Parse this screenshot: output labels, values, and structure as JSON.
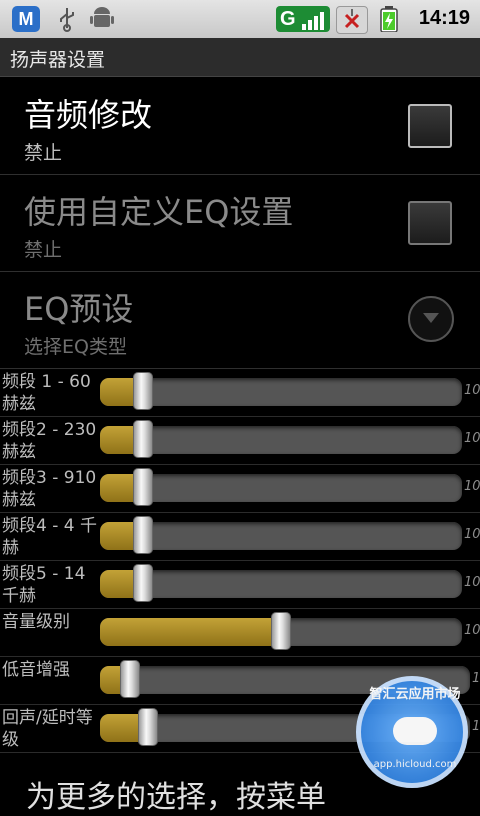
{
  "status_bar": {
    "app_icon_letter": "M",
    "network_letter": "G",
    "time": "14:19",
    "icons": [
      "m-app-icon",
      "usb-icon",
      "android-debug-icon",
      "network-signal-icon",
      "sim-card-icon",
      "battery-charging-icon"
    ]
  },
  "title": "扬声器设置",
  "prefs": [
    {
      "title": "音频修改",
      "summary": "禁止",
      "control": "checkbox",
      "checked": false,
      "enabled": true
    },
    {
      "title": "使用自定义EQ设置",
      "summary": "禁止",
      "control": "checkbox",
      "checked": false,
      "enabled": false
    },
    {
      "title": "EQ预设",
      "summary": "选择EQ类型",
      "control": "dropdown",
      "enabled": false
    }
  ],
  "bands": [
    {
      "label": "频段 1 - 60 赫兹",
      "max": "10",
      "value_fraction": 0.12
    },
    {
      "label": "频段2 - 230 赫兹",
      "max": "10",
      "value_fraction": 0.12
    },
    {
      "label": "频段3 - 910 赫兹",
      "max": "10",
      "value_fraction": 0.12
    },
    {
      "label": "频段4 - 4 千赫",
      "max": "10",
      "value_fraction": 0.12
    },
    {
      "label": "频段5 - 14 千赫",
      "max": "10",
      "value_fraction": 0.12
    },
    {
      "label": "音量级别",
      "max": "10",
      "value_fraction": 0.5
    },
    {
      "label": "低音增强",
      "max": "1",
      "value_fraction": 0.08
    },
    {
      "label": "回声/延时等级",
      "max": "1",
      "value_fraction": 0.13
    }
  ],
  "footer_hint": "为更多的选择，按菜单",
  "watermark": {
    "brand": "智汇云应用市场",
    "url": "app.hicloud.com"
  },
  "colors": {
    "accent_fill": "#b8962b",
    "status_bg": "#d6d6d6",
    "title_bg": "#2c2c2c"
  }
}
